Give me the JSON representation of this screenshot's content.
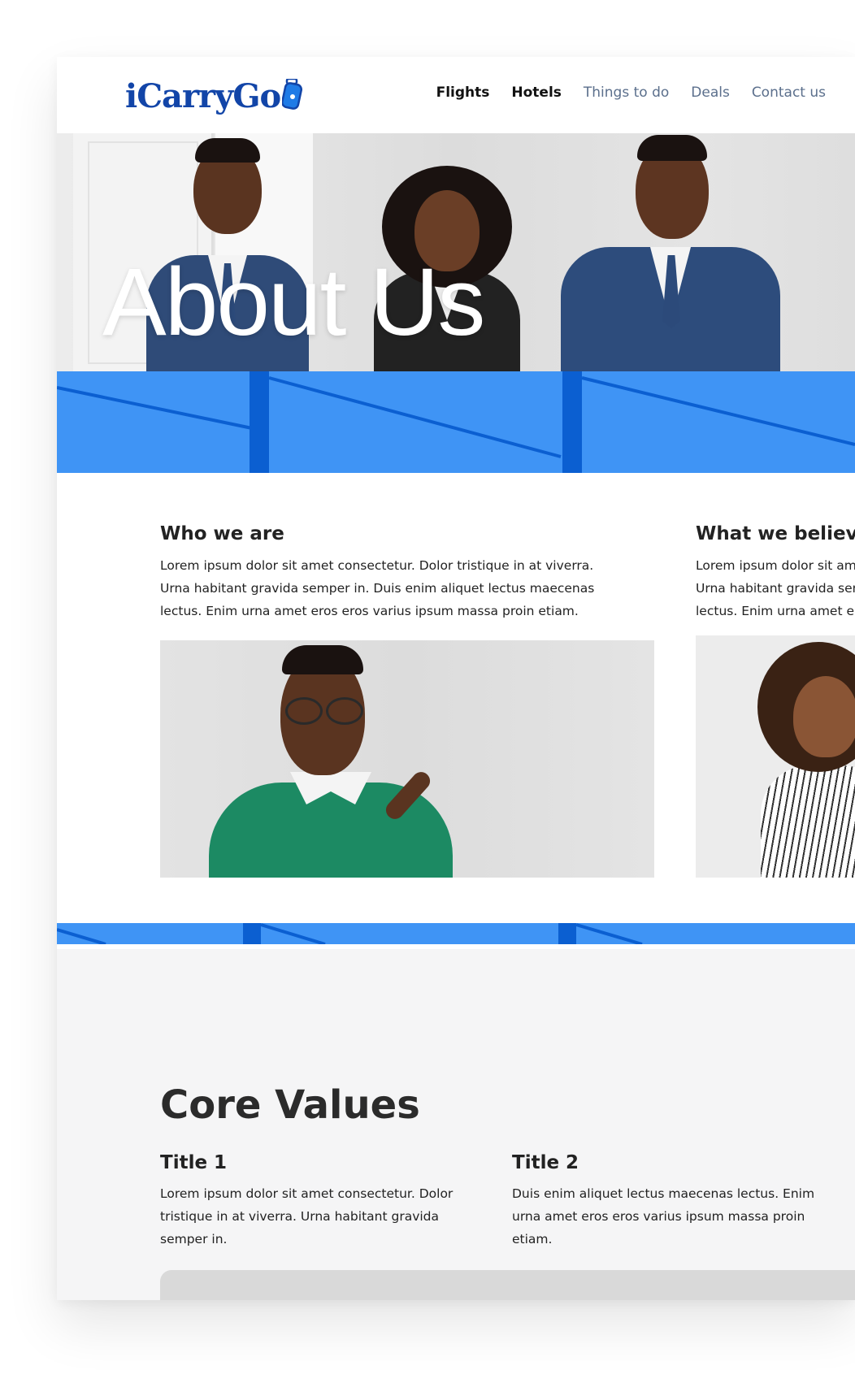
{
  "header": {
    "logo_text": "iCarryGo",
    "nav": [
      {
        "label": "Flights"
      },
      {
        "label": "Hotels"
      },
      {
        "label": "Things to do"
      },
      {
        "label": "Deals"
      },
      {
        "label": "Contact us"
      }
    ]
  },
  "hero": {
    "title": "About Us"
  },
  "about": {
    "who": {
      "title": "Who we are",
      "lines": [
        "Lorem ipsum dolor sit amet consectetur. Dolor tristique in at viverra.",
        "Urna habitant gravida semper in. Duis enim aliquet lectus maecenas",
        "lectus. Enim urna amet eros eros varius ipsum massa proin etiam."
      ]
    },
    "believe": {
      "title": "What we believe",
      "lines": [
        "Lorem ipsum dolor sit amet consectetur.",
        "Urna habitant gravida semper in.",
        "lectus. Enim urna amet eros eros varius."
      ]
    }
  },
  "core": {
    "title": "Core Values",
    "values": [
      {
        "title": "Title 1",
        "lines": [
          "Lorem ipsum dolor sit amet consectetur. Dolor",
          "tristique in at viverra. Urna habitant gravida",
          "semper in."
        ]
      },
      {
        "title": "Title 2",
        "lines": [
          "Duis enim aliquet lectus maecenas lectus. Enim",
          "urna amet eros eros varius ipsum massa proin",
          "etiam."
        ]
      }
    ]
  },
  "colors": {
    "brand_blue": "#3f94f5",
    "logo_blue": "#1245a8",
    "nav_muted": "#5b6f8c"
  }
}
